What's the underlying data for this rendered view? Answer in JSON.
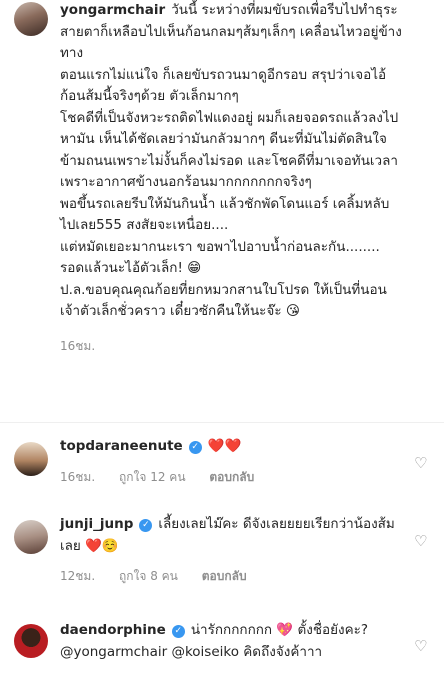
{
  "comments": [
    {
      "username": "yongarmchair",
      "verified": false,
      "text": "วันนี้ ระหว่างที่ผมขับรถเพื่อรีบไปทำธุระ สายตาก็เหลือบไปเห็นก้อนกลมๆส้มๆเล็กๆ เคลื่อนไหวอยู่ข้างทาง\nตอนแรกไม่แน่ใจ ก็เลยขับรถวนมาดูอีกรอบ สรุปว่าเจอไอ้ก้อนส้มนี้จริงๆด้วย ตัวเล็กมากๆ\nโชคดีที่เป็นจังหวะรถติดไฟแดงอยู่ ผมก็เลยจอดรถแล้วลงไปหามัน เห็นได้ชัดเลยว่ามันกลัวมากๆ ดีนะที่มันไม่ตัดสินใจข้ามถนนเพราะไม่งั้นก็คงไม่รอด และโชคดีที่มาเจอทันเวลาเพราะอากาศข้างนอกร้อนมากกกกกกกจริงๆ\nพอขึ้นรถเลยรีบให้มันกินน้ำ แล้วชักพัดโดนแอร์ เคลิ้มหลับไปเลย555 สงสัยจะเหนื่อย....\nแต่หมัดเยอะมากนะเรา  ขอพาไปอาบน้ำก่อนละกัน........\nรอดแล้วนะไอ้ตัวเล็ก! 😁\nป.ล.ขอบคุณคุณก้อยที่ยกหมวกสานใบโปรด ให้เป็นที่นอนเจ้าตัวเล็กชั่วคราว  เดี๋ยวซักคืนให้นะจ๊ะ 😘",
      "time": "16ชม.",
      "likes": "",
      "reply": ""
    },
    {
      "username": "topdaraneenute",
      "verified": true,
      "text": "❤️❤️",
      "time": "16ชม.",
      "likes": "ถูกใจ 12 คน",
      "reply": "ตอบกลับ"
    },
    {
      "username": "junji_junp",
      "verified": true,
      "text": "เลี้ยงเลยไม๊คะ ดีจังเลยยยยเรียกว่าน้องส้มเลย ❤️☺️",
      "time": "12ชม.",
      "likes": "ถูกใจ 8 คน",
      "reply": "ตอบกลับ"
    },
    {
      "username": "daendorphine",
      "verified": true,
      "text": "น่ารักกกกกกก 💖  ตั้งชื่อยังคะ? @yongarmchair @koiseiko คิดถึงจังค้าาา",
      "time": "",
      "likes": "",
      "reply": ""
    }
  ],
  "icons": {
    "like": "heart-outline-icon",
    "verified": "verified-badge-icon"
  },
  "colors": {
    "verified": "#3897f0",
    "meta": "#8e8e8e",
    "text": "#262626"
  }
}
